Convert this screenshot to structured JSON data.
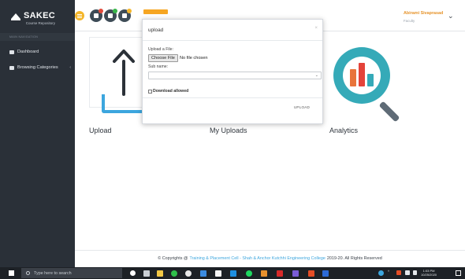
{
  "sidebar": {
    "brand": "SAKEC",
    "brand_sub": "Course Repository",
    "nav_header": "MAIN NAVIGATION",
    "items": [
      {
        "label": "Dashboard"
      },
      {
        "label": "Browsing Categories"
      }
    ]
  },
  "header": {
    "user_name": "Abirami Sivaprasad",
    "user_role": "Faculty"
  },
  "main": {
    "cards": [
      {
        "label": "Upload"
      },
      {
        "label": "My Uploads"
      },
      {
        "label": "Analytics"
      }
    ]
  },
  "modal": {
    "title": "upload",
    "close": "×",
    "file_label": "Upload a File:",
    "file_button": "Choose File",
    "file_status": "No file chosen",
    "sub_label": "Sub name:",
    "sub_value": "",
    "checkbox_label": "Download allowed",
    "submit_label": "UPLOAD"
  },
  "footer": {
    "prefix": "© Copyrights @",
    "link": "Training & Placement Cell - Shah & Anchor Kutchhi Engineering College",
    "suffix": "2019-20. All Rights Reserved"
  },
  "taskbar": {
    "search_placeholder": "Type here to search",
    "time": "1:03 PM",
    "date": "10/25/2020"
  },
  "colors": {
    "sidebar": "#2a3038",
    "accent": "#f4b62a",
    "primary": "#3ca6de"
  }
}
